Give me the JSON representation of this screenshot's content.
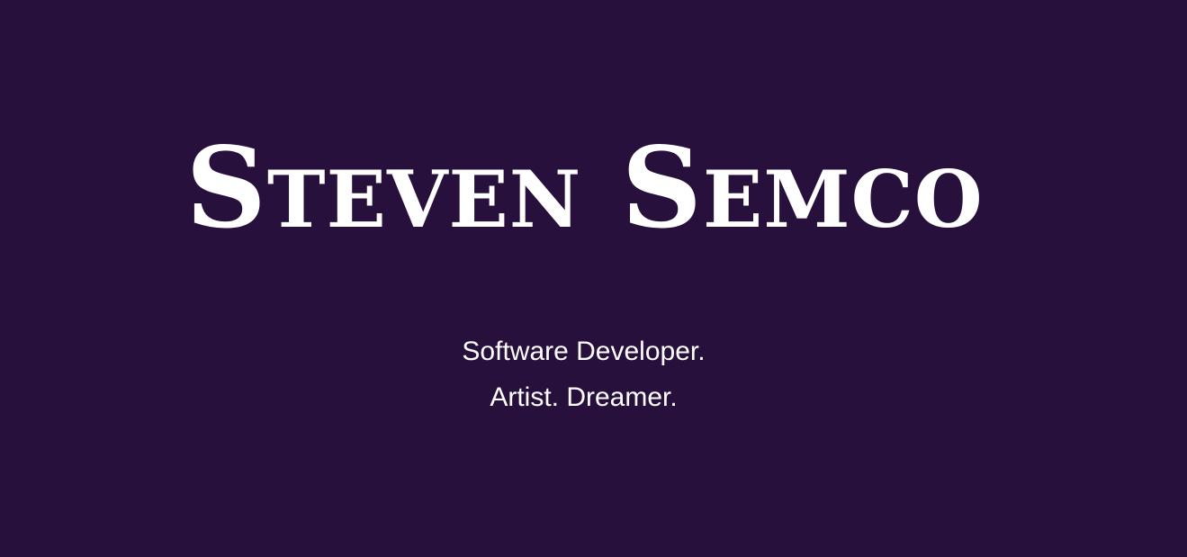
{
  "hero": {
    "title": "Steven Semco",
    "tagline_line_1": "Software Developer.",
    "tagline_line_2": "Artist. Dreamer."
  },
  "colors": {
    "background": "#27103c",
    "text": "#ffffff"
  }
}
